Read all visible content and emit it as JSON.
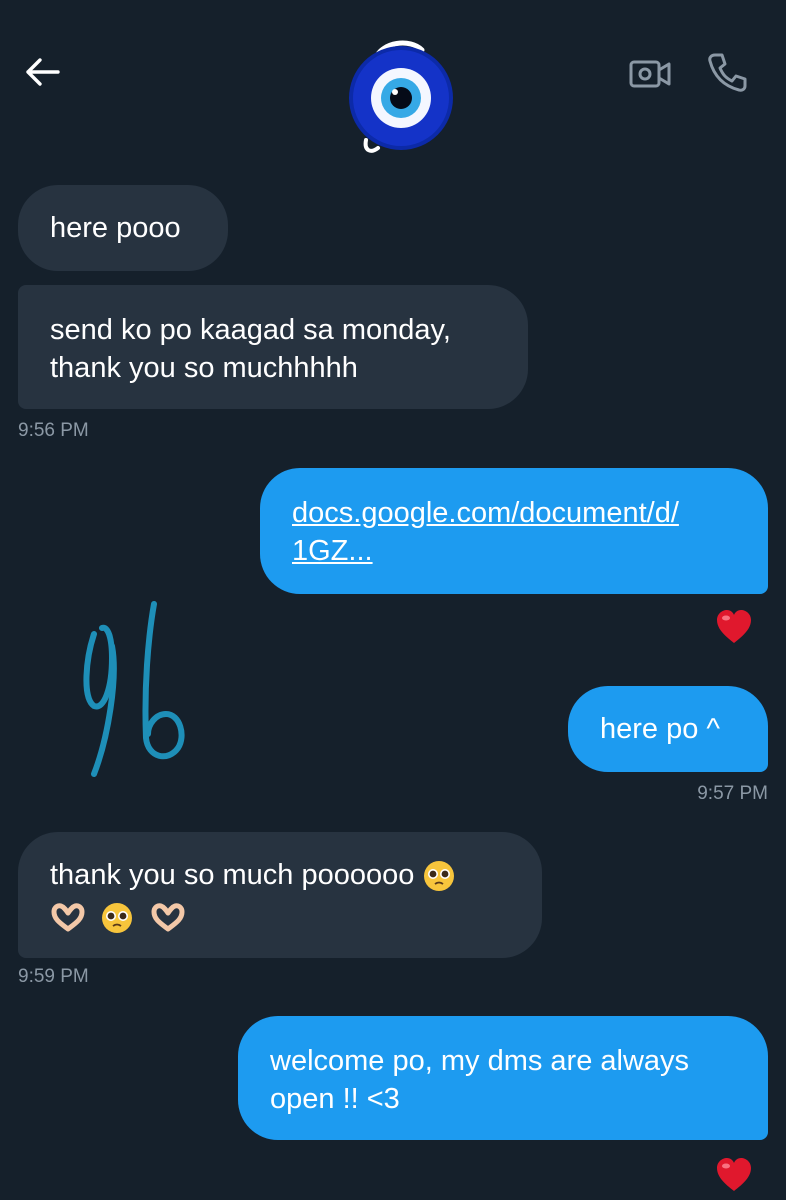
{
  "header": {
    "back_icon": "arrow-left-icon",
    "avatar_icon": "evil-eye-avatar",
    "video_icon": "video-camera-icon",
    "phone_icon": "phone-icon"
  },
  "messages": [
    {
      "side": "incoming",
      "text": "here pooo"
    },
    {
      "side": "incoming",
      "line1": "send ko po kaagad sa monday,",
      "line2": "thank you so muchhhhh",
      "time": "9:56 PM"
    },
    {
      "side": "outgoing",
      "link_line1": "docs.google.com/document/d/",
      "link_line2": "1GZ...",
      "reaction": "heart"
    },
    {
      "side": "outgoing",
      "text": "here po ^",
      "time": "9:57 PM"
    },
    {
      "side": "incoming",
      "line1": "thank you so much poooooo",
      "emojis": [
        "pleading-face",
        "heart-hands",
        "pleading-face",
        "heart-hands"
      ],
      "time": "9:59 PM"
    },
    {
      "side": "outgoing",
      "line1": "welcome po, my dms are always",
      "line2": "open !! <3",
      "reaction": "heart"
    }
  ],
  "colors": {
    "background": "#15202b",
    "incoming_bubble": "#273340",
    "outgoing_bubble": "#1d9bf0",
    "timestamp": "#8b98a5",
    "signature": "#1e8fb8",
    "heart": "#e0182d"
  }
}
